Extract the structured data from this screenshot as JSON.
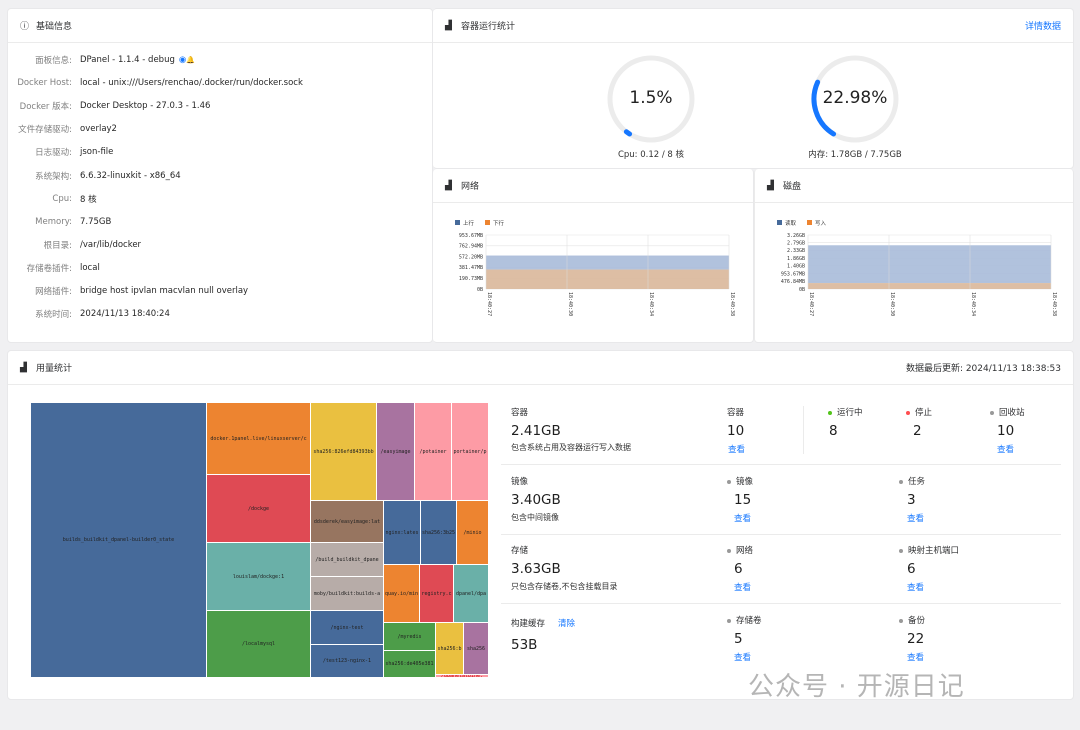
{
  "basic": {
    "title": "基础信息",
    "rows": [
      {
        "label": "面板信息:",
        "value": "DPanel - 1.1.4 - debug"
      },
      {
        "label": "Docker Host:",
        "value": "local - unix:///Users/renchao/.docker/run/docker.sock"
      },
      {
        "label": "Docker 版本:",
        "value": "Docker Desktop - 27.0.3 - 1.46"
      },
      {
        "label": "文件存储驱动:",
        "value": "overlay2"
      },
      {
        "label": "日志驱动:",
        "value": "json-file"
      },
      {
        "label": "系统架构:",
        "value": "6.6.32-linuxkit - x86_64"
      },
      {
        "label": "Cpu:",
        "value": "8 核"
      },
      {
        "label": "Memory:",
        "value": "7.75GB"
      },
      {
        "label": "根目录:",
        "value": "/var/lib/docker"
      },
      {
        "label": "存储卷插件:",
        "value": "local"
      },
      {
        "label": "网络插件:",
        "value": "bridge  host  ipvlan  macvlan  null  overlay"
      },
      {
        "label": "系统时间:",
        "value": "2024/11/13 18:40:24"
      }
    ]
  },
  "runtime": {
    "title": "容器运行统计",
    "detail_link": "详情数据",
    "cpu": {
      "value": "1.5%",
      "label": "Cpu: 0.12 / 8 核",
      "fraction": 0.015
    },
    "memory": {
      "value": "22.98%",
      "label": "内存: 1.78GB / 7.75GB",
      "fraction": 0.2298
    }
  },
  "network": {
    "title": "网络",
    "legend": [
      "上行",
      "下行"
    ],
    "yticks": [
      "953.67MB",
      "762.94MB",
      "572.20MB",
      "381.47MB",
      "190.73MB",
      "0B"
    ],
    "xticks": [
      "18:40:27",
      "18:40:30",
      "18:40:34",
      "18:40:38"
    ],
    "colors": [
      "#a9bbd9",
      "#d9b79a"
    ]
  },
  "disk": {
    "title": "磁盘",
    "legend": [
      "读取",
      "写入"
    ],
    "yticks": [
      "3.26GB",
      "2.79GB",
      "2.33GB",
      "1.86GB",
      "1.40GB",
      "953.67MB",
      "476.84MB",
      "0B"
    ],
    "xticks": [
      "18:40:27",
      "18:40:30",
      "18:40:34",
      "18:40:38"
    ],
    "colors": [
      "#a9bbd9",
      "#d9b79a"
    ]
  },
  "usage": {
    "title": "用量统计",
    "updated": "数据最后更新: 2024/11/13 18:38:53",
    "treemap": [
      {
        "label": "builds_buildkit_dpanel-builder0_state",
        "color": "#466a9a"
      },
      {
        "label": "docker.1panel.live/linuxserver/c",
        "color": "#ed8430"
      },
      {
        "label": "/dockge",
        "color": "#df4a54"
      },
      {
        "label": "louislam/dockge:1",
        "color": "#6ab0a8"
      },
      {
        "label": "/localmysql",
        "color": "#4d9d49"
      },
      {
        "label": "sha256:826efd84393bb",
        "color": "#eac040"
      },
      {
        "label": "/easyimage",
        "color": "#a873a0"
      },
      {
        "label": "/potainer",
        "color": "#fd9ba5"
      },
      {
        "label": "portainer/p",
        "color": "#fd9ba5"
      },
      {
        "label": "ddsderek/easyimage:lat",
        "color": "#977560"
      },
      {
        "label": "/build_buildkit_dpane",
        "color": "#b7aca8"
      },
      {
        "label": "moby/buildkit:builds-a",
        "color": "#b7aca8"
      },
      {
        "label": "nginx:lates",
        "color": "#466a9a"
      },
      {
        "label": "sha256:3b25",
        "color": "#466a9a"
      },
      {
        "label": "/minio",
        "color": "#ed8430"
      },
      {
        "label": "quay.io/min",
        "color": "#ed8430"
      },
      {
        "label": "registry.c",
        "color": "#df4a54"
      },
      {
        "label": "dpanel/dpa",
        "color": "#6ab0a8"
      },
      {
        "label": "/nginx-test",
        "color": "#466a9a"
      },
      {
        "label": "/test123-nginx-1",
        "color": "#466a9a"
      },
      {
        "label": "/myredis",
        "color": "#4d9d49"
      },
      {
        "label": "sha256:de405e381",
        "color": "#4d9d49"
      },
      {
        "label": "sha256:b",
        "color": "#eac040"
      },
      {
        "label": "sha256",
        "color": "#a873a0"
      },
      {
        "label": "/dpanelalpine:",
        "color": "#fd9ba5"
      }
    ],
    "container": {
      "title": "容器",
      "size": "2.41GB",
      "desc": "包含系统占用及容器运行写入数据",
      "count_label": "容器",
      "count": "10",
      "view": "查看",
      "running_label": "运行中",
      "running": "8",
      "stopped_label": "停止",
      "stopped": "2",
      "recycle_label": "回收站",
      "recycle": "10",
      "recycle_view": "查看"
    },
    "image": {
      "title": "镜像",
      "size": "3.40GB",
      "desc": "包含中间镜像",
      "count_label": "镜像",
      "count": "15",
      "view": "查看",
      "task_label": "任务",
      "task": "3",
      "task_view": "查看"
    },
    "storage": {
      "title": "存储",
      "size": "3.63GB",
      "desc": "只包含存储卷,不包含挂载目录",
      "net_label": "网络",
      "net": "6",
      "view": "查看",
      "port_label": "映射主机端口",
      "port": "6",
      "port_view": "查看"
    },
    "cache": {
      "title": "构建缓存",
      "clear": "清除",
      "size": "53B",
      "vol_label": "存储卷",
      "vol": "5",
      "view": "查看",
      "backup_label": "备份",
      "backup": "22",
      "backup_view": "查看"
    },
    "status_colors": {
      "running": "#52c41a",
      "stopped": "#ff4d4f",
      "neutral": "#999999"
    }
  },
  "watermark": "公众号 · 开源日记"
}
